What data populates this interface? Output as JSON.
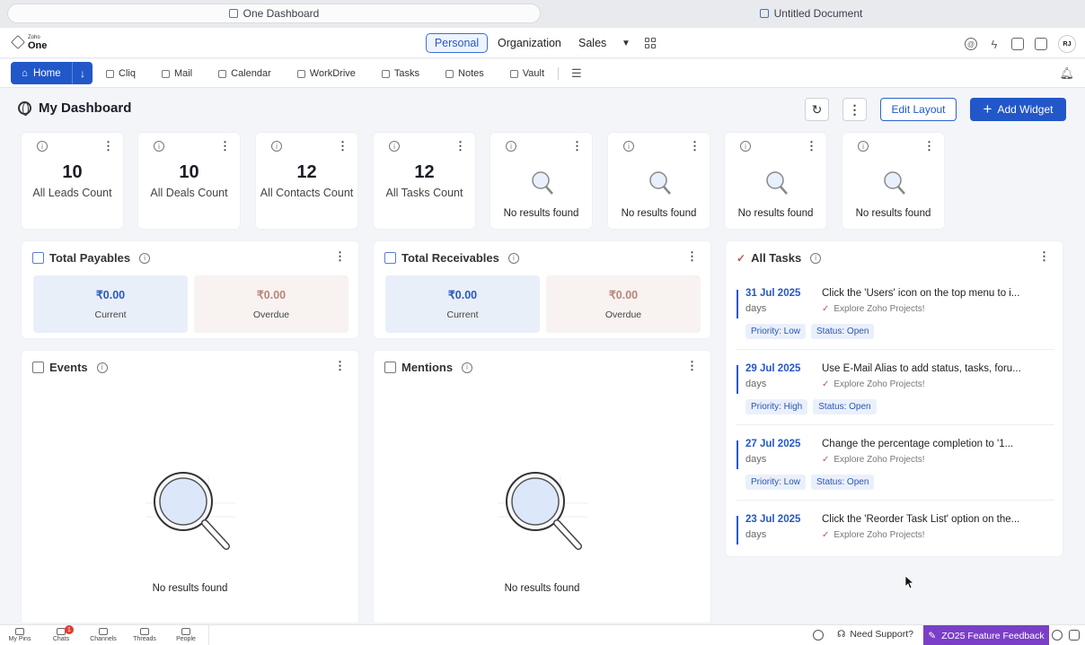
{
  "browser": {
    "tabs": [
      {
        "label": "One Dashboard"
      },
      {
        "label": "Untitled Document"
      }
    ]
  },
  "header": {
    "logo_small": "Zoho",
    "logo_big": "One",
    "segments": {
      "personal": "Personal",
      "organization": "Organization",
      "sales": "Sales"
    },
    "avatar": "RJ"
  },
  "nav": {
    "home": "Home",
    "items": [
      {
        "label": "Cliq"
      },
      {
        "label": "Mail"
      },
      {
        "label": "Calendar"
      },
      {
        "label": "WorkDrive"
      },
      {
        "label": "Tasks"
      },
      {
        "label": "Notes"
      },
      {
        "label": "Vault"
      }
    ]
  },
  "dashboard": {
    "title": "My Dashboard",
    "edit_layout": "Edit Layout",
    "add_widget": "Add Widget"
  },
  "counts": [
    {
      "value": "10",
      "label": "All Leads Count"
    },
    {
      "value": "10",
      "label": "All Deals Count"
    },
    {
      "value": "12",
      "label": "All Contacts Count"
    },
    {
      "value": "12",
      "label": "All Tasks Count"
    }
  ],
  "empty_cards": [
    {
      "text": "No results found"
    },
    {
      "text": "No results found"
    },
    {
      "text": "No results found"
    },
    {
      "text": "No results found"
    }
  ],
  "payables": {
    "title": "Total Payables",
    "current_amount": "₹0.00",
    "current_label": "Current",
    "overdue_amount": "₹0.00",
    "overdue_label": "Overdue"
  },
  "receivables": {
    "title": "Total Receivables",
    "current_amount": "₹0.00",
    "current_label": "Current",
    "overdue_amount": "₹0.00",
    "overdue_label": "Overdue"
  },
  "events": {
    "title": "Events",
    "empty": "No results found"
  },
  "mentions": {
    "title": "Mentions",
    "empty": "No results found"
  },
  "tasks": {
    "title": "All Tasks",
    "items": [
      {
        "date": "31 Jul 2025",
        "days": "days",
        "title": "Click the 'Users' icon on the top menu to i...",
        "project": "Explore Zoho Projects!",
        "priority": "Priority: Low",
        "status": "Status: Open"
      },
      {
        "date": "29 Jul 2025",
        "days": "days",
        "title": "Use E-Mail Alias to add status, tasks, foru...",
        "project": "Explore Zoho Projects!",
        "priority": "Priority: High",
        "status": "Status: Open"
      },
      {
        "date": "27 Jul 2025",
        "days": "days",
        "title": "Change the percentage completion to '1...",
        "project": "Explore Zoho Projects!",
        "priority": "Priority: Low",
        "status": "Status: Open"
      },
      {
        "date": "23 Jul 2025",
        "days": "days",
        "title": "Click the 'Reorder Task List' option on the...",
        "project": "Explore Zoho Projects!",
        "priority": "",
        "status": ""
      }
    ]
  },
  "bottombar": {
    "items": [
      {
        "label": "My Pins"
      },
      {
        "label": "Chats"
      },
      {
        "label": "Channels"
      },
      {
        "label": "Threads"
      },
      {
        "label": "People"
      }
    ],
    "chats_badge": "1",
    "support": "Need Support?",
    "feedback": "ZO25 Feature Feedback"
  },
  "colors": {
    "accent": "#2257c9",
    "feedback": "#7b3fc7",
    "badge": "#e03c31"
  }
}
